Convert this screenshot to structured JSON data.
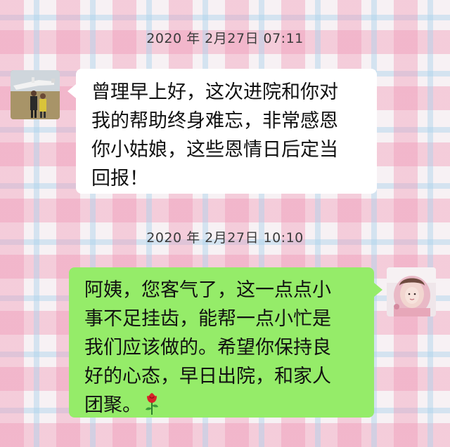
{
  "chat": {
    "messages": [
      {
        "timestamp": "2020 年 2月27日  07:11",
        "side": "left",
        "avatar_icon": "person-with-airplane-avatar",
        "lines": [
          "曾理早上好，这次进院和你对",
          "我的帮助终身难忘，非常感恩",
          "你小姑娘，这些恩情日后定当",
          "回报！"
        ]
      },
      {
        "timestamp": "2020 年 2月27日  10:10",
        "side": "right",
        "avatar_icon": "girl-pink-avatar",
        "lines": [
          "阿姨，您客气了，这一点点小",
          "事不足挂齿，能帮一点小忙是",
          "我们应该做的。希望你保持良",
          "好的心态，早日出院，和家人",
          "团聚。"
        ],
        "emoji": "rose-icon"
      }
    ]
  },
  "colors": {
    "sent_bubble": "#95ec69",
    "received_bubble": "#ffffff",
    "plaid_pink": "#f096b4",
    "plaid_blue": "#aad2eb"
  }
}
